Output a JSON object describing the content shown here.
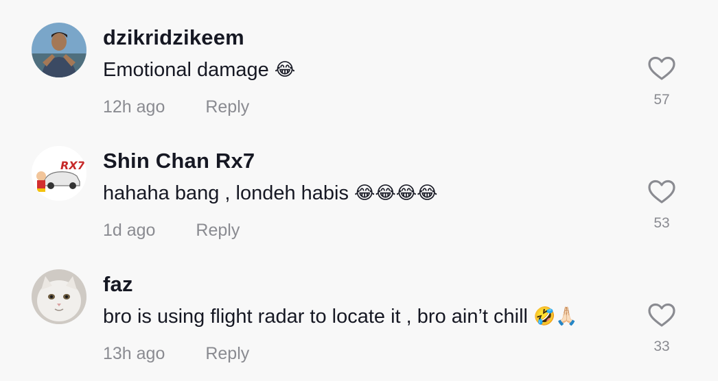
{
  "comments": [
    {
      "username": "dzikridzikeem",
      "text": "Emotional damage",
      "emojis": "😂",
      "time": "12h ago",
      "reply_label": "Reply",
      "likes": "57",
      "avatar_icon": "person-photo-icon"
    },
    {
      "username": "Shin Chan Rx7",
      "text": "hahaha bang , londeh habis",
      "emojis": "😂😂😂😂",
      "time": "1d ago",
      "reply_label": "Reply",
      "likes": "53",
      "avatar_icon": "cartoon-car-icon"
    },
    {
      "username": "faz",
      "text": "bro is using flight radar to locate it , bro ain’t chill",
      "emojis": "🤣🙏🏻",
      "time": "13h ago",
      "reply_label": "Reply",
      "likes": "33",
      "avatar_icon": "white-cat-photo-icon"
    }
  ],
  "colors": {
    "background": "#f8f8f8",
    "text_primary": "#161823",
    "text_secondary": "#8a8b91"
  }
}
